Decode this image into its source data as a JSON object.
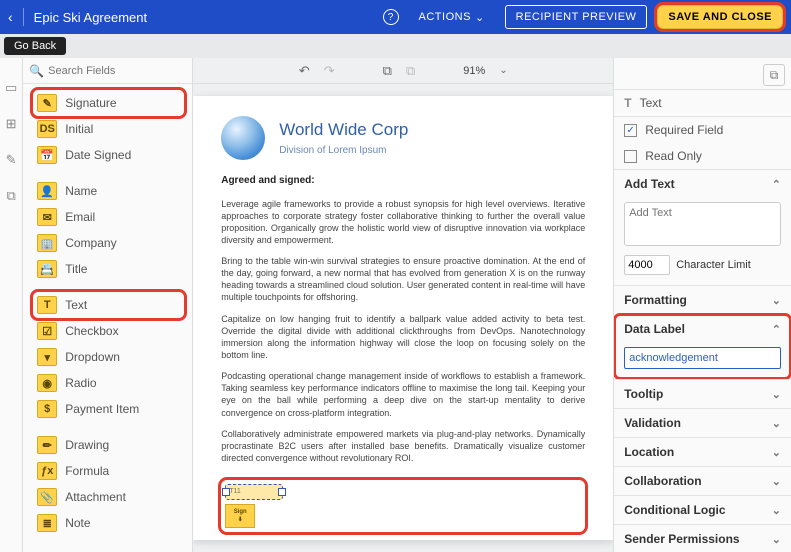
{
  "header": {
    "title": "Epic Ski Agreement",
    "actions_label": "ACTIONS",
    "recipient_preview_label": "RECIPIENT PREVIEW",
    "save_close_label": "SAVE AND CLOSE",
    "help_label": "?"
  },
  "goback": {
    "label": "Go Back"
  },
  "search": {
    "placeholder": "Search Fields",
    "clear": "✕",
    "icon": "🔍"
  },
  "fields": {
    "signature": "Signature",
    "initial": "Initial",
    "date_signed": "Date Signed",
    "name": "Name",
    "email": "Email",
    "company": "Company",
    "title": "Title",
    "text": "Text",
    "checkbox": "Checkbox",
    "dropdown": "Dropdown",
    "radio": "Radio",
    "payment_item": "Payment Item",
    "drawing": "Drawing",
    "formula": "Formula",
    "attachment": "Attachment",
    "note": "Note"
  },
  "toolbar": {
    "undo": "↶",
    "redo": "↷",
    "copy": "⧉",
    "paste": "⧉",
    "zoom": "91%",
    "zoom_chev": "⌄"
  },
  "doc": {
    "corp_name": "World Wide Corp",
    "corp_sub": "Division of Lorem Ipsum",
    "agreed": "Agreed and signed:",
    "p1": "Leverage agile frameworks to provide a robust synopsis for high level overviews. Iterative approaches to corporate strategy foster collaborative thinking to further the overall value proposition. Organically grow the holistic world view of disruptive innovation via workplace diversity and empowerment.",
    "p2": "Bring to the table win-win survival strategies to ensure proactive domination. At the end of the day, going forward, a new normal that has evolved from generation X is on the runway heading towards a streamlined cloud solution. User generated content in real-time will have multiple touchpoints for offshoring.",
    "p3": "Capitalize on low hanging fruit to identify a ballpark value added activity to beta test. Override the digital divide with additional clickthroughs from DevOps. Nanotechnology immersion along the information highway will close the loop on focusing solely on the bottom line.",
    "p4": "Podcasting operational change management inside of workflows to establish a framework. Taking seamless key performance indicators offline to maximise the long tail. Keeping your eye on the ball while performing a deep dive on the start-up mentality to derive convergence on cross-platform integration.",
    "p5": "Collaboratively administrate empowered markets via plug-and-play networks. Dynamically procrastinate B2C users after installed base benefits. Dramatically visualize customer directed convergence without revolutionary ROI.",
    "placed_text": "T11",
    "sign_tab_top": "Sign",
    "sign_tab_icon": "⬇"
  },
  "right": {
    "text_label": "Text",
    "required_label": "Required Field",
    "readonly_label": "Read Only",
    "add_text_header": "Add Text",
    "add_text_placeholder": "Add Text",
    "char_limit_value": "4000",
    "char_limit_label": "Character Limit",
    "formatting_header": "Formatting",
    "data_label_header": "Data Label",
    "data_label_value": "acknowledgement",
    "tooltip_header": "Tooltip",
    "validation_header": "Validation",
    "location_header": "Location",
    "collaboration_header": "Collaboration",
    "conditional_header": "Conditional Logic",
    "sender_perm_header": "Sender Permissions"
  }
}
